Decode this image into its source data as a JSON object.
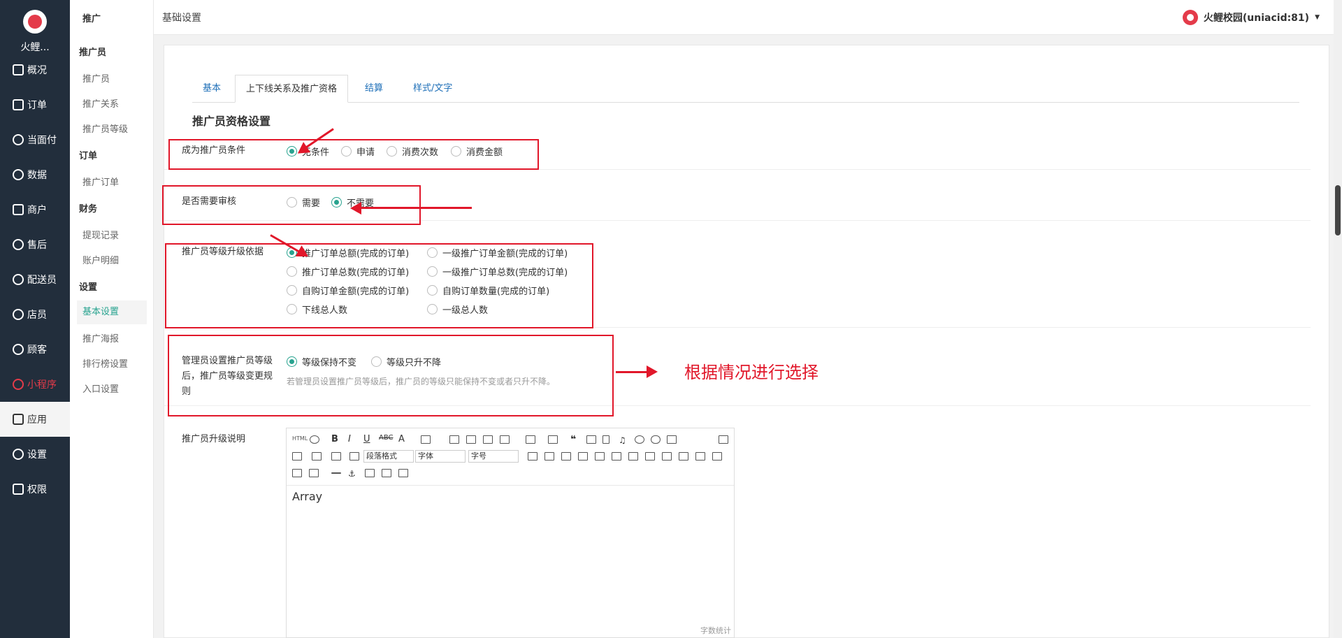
{
  "app": {
    "name": "火鲤...",
    "brand_color": "#e43b4a"
  },
  "sidebar": {
    "items": [
      {
        "label": "概况",
        "icon": "dashboard-icon"
      },
      {
        "label": "订单",
        "icon": "order-icon"
      },
      {
        "label": "当面付",
        "icon": "yuan-icon"
      },
      {
        "label": "数据",
        "icon": "chart-icon"
      },
      {
        "label": "商户",
        "icon": "store-icon"
      },
      {
        "label": "售后",
        "icon": "headset-icon"
      },
      {
        "label": "配送员",
        "icon": "courier-icon"
      },
      {
        "label": "店员",
        "icon": "clerk-icon"
      },
      {
        "label": "顾客",
        "icon": "customer-icon"
      },
      {
        "label": "小程序",
        "icon": "miniapp-icon"
      },
      {
        "label": "应用",
        "icon": "apps-icon"
      },
      {
        "label": "设置",
        "icon": "gear-icon"
      },
      {
        "label": "权限",
        "icon": "lock-icon"
      }
    ]
  },
  "subnav": {
    "title": "推广",
    "groups": [
      {
        "head": "推广员",
        "items": [
          "推广员",
          "推广关系",
          "推广员等级"
        ]
      },
      {
        "head": "订单",
        "items": [
          "推广订单"
        ]
      },
      {
        "head": "财务",
        "items": [
          "提现记录",
          "账户明细"
        ]
      },
      {
        "head": "设置",
        "items": [
          "基本设置",
          "推广海报",
          "排行榜设置",
          "入口设置"
        ]
      }
    ]
  },
  "header": {
    "breadcrumb": "基础设置",
    "user": "火鲤校园(uniacid:81)"
  },
  "tabs": [
    "基本",
    "上下线关系及推广资格",
    "结算",
    "样式/文字"
  ],
  "section_title": "推广员资格设置",
  "form": {
    "condition": {
      "label": "成为推广员条件",
      "options": [
        "无条件",
        "申请",
        "消费次数",
        "消费金额"
      ],
      "selected": "无条件"
    },
    "review": {
      "label": "是否需要审核",
      "options": [
        "需要",
        "不需要"
      ],
      "selected": "不需要"
    },
    "upgrade_basis": {
      "label": "推广员等级升级依据",
      "options": [
        "推广订单总额(完成的订单)",
        "一级推广订单金额(完成的订单)",
        "推广订单总数(完成的订单)",
        "一级推广订单总数(完成的订单)",
        "自购订单金额(完成的订单)",
        "自购订单数量(完成的订单)",
        "下线总人数",
        "一级总人数"
      ],
      "selected": "推广订单总额(完成的订单)"
    },
    "level_rule": {
      "label": "管理员设置推广员等级后，推广员等级变更规则",
      "options": [
        "等级保持不变",
        "等级只升不降"
      ],
      "selected": "等级保持不变",
      "hint": "若管理员设置推广员等级后，推广员的等级只能保持不变或者只升不降。"
    },
    "upgrade_desc": {
      "label": "推广员升级说明",
      "content": "Array",
      "para_format": "段落格式",
      "font": "字体",
      "font_size": "字号",
      "word_count": "字数统计"
    }
  },
  "annotation": {
    "text": "根据情况进行选择",
    "color": "#e1172a"
  },
  "accent_color": "#28a38f"
}
